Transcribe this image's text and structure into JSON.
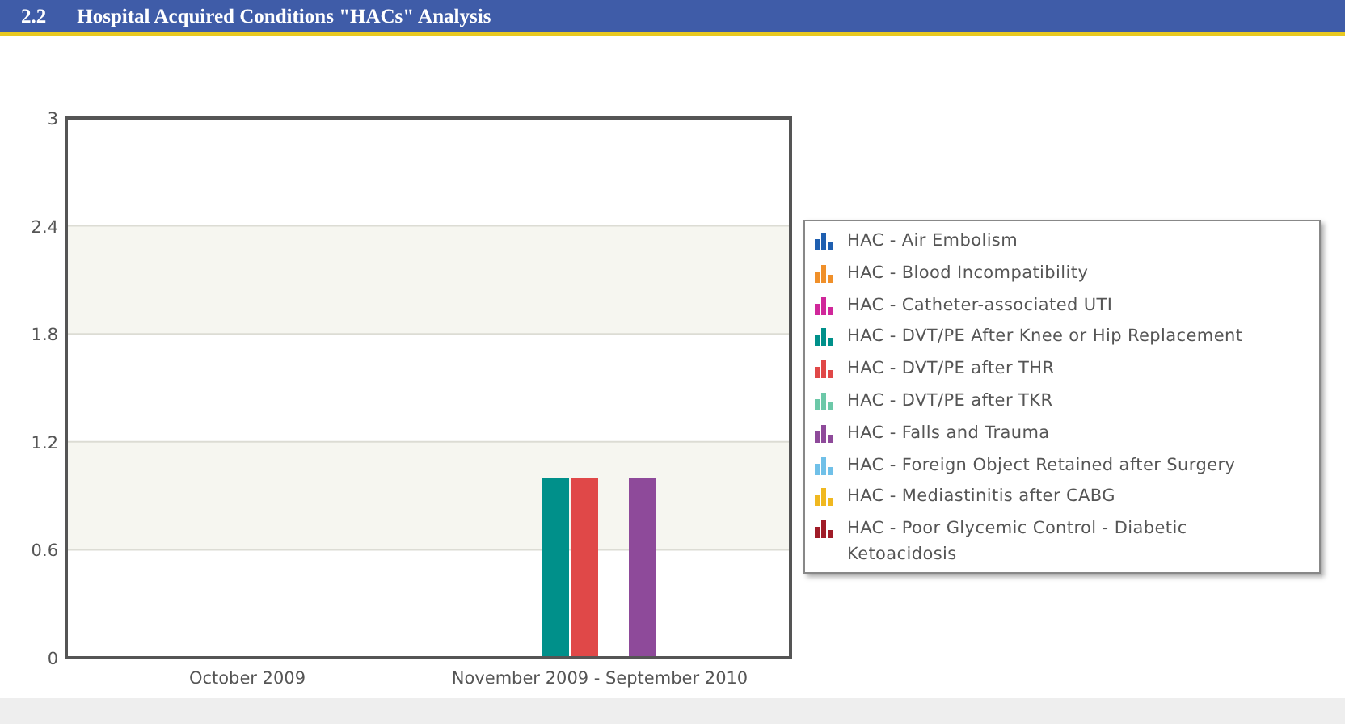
{
  "header": {
    "number": "2.2",
    "title": "Hospital Acquired Conditions \"HACs\" Analysis"
  },
  "chart_data": {
    "type": "bar",
    "categories": [
      "October 2009",
      "November 2009 - September 2010"
    ],
    "ylim": [
      0,
      3
    ],
    "grid": true,
    "legend": "right",
    "yticks": [
      0,
      0.6,
      1.2,
      1.8,
      2.4,
      3
    ],
    "series": [
      {
        "name": "HAC - Air Embolism",
        "color": "#1f5fb0",
        "values": [
          0,
          0
        ]
      },
      {
        "name": "HAC - Blood Incompatibility",
        "color": "#f0902a",
        "values": [
          0,
          0
        ]
      },
      {
        "name": "HAC - Catheter-associated UTI",
        "color": "#d0279a",
        "values": [
          0,
          0
        ]
      },
      {
        "name": "HAC - DVT/PE After Knee or Hip Replacement",
        "color": "#00908a",
        "values": [
          0,
          1
        ]
      },
      {
        "name": "HAC - DVT/PE after THR",
        "color": "#e04848",
        "values": [
          0,
          1
        ]
      },
      {
        "name": "HAC - DVT/PE after TKR",
        "color": "#6cc8a8",
        "values": [
          0,
          0
        ]
      },
      {
        "name": "HAC - Falls and Trauma",
        "color": "#8e4a9a",
        "values": [
          0,
          1
        ]
      },
      {
        "name": "HAC - Foreign Object Retained after Surgery",
        "color": "#70c0e8",
        "values": [
          0,
          0
        ]
      },
      {
        "name": "HAC - Mediastinitis after CABG",
        "color": "#f0b820",
        "values": [
          0,
          0
        ]
      },
      {
        "name": "HAC - Poor Glycemic Control - Diabetic Ketoacidosis",
        "color": "#a01c28",
        "values": [
          0,
          0
        ]
      }
    ]
  }
}
